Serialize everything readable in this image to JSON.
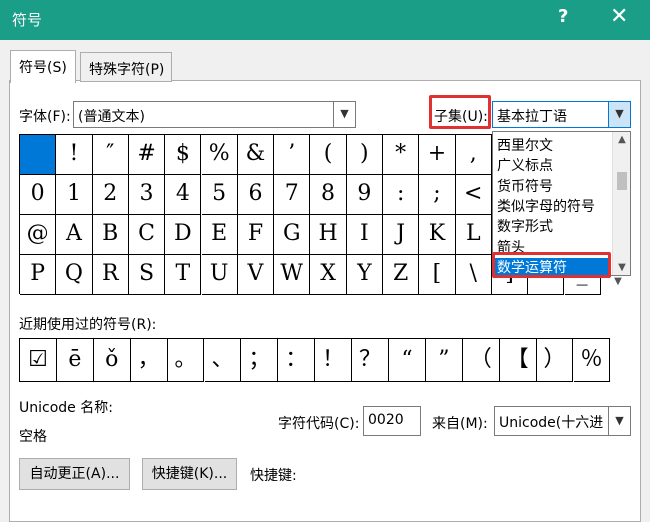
{
  "window": {
    "title": "符号",
    "help": "?",
    "close": "✕"
  },
  "tabs": [
    {
      "label": "符号(S)"
    },
    {
      "label": "特殊字符(P)"
    }
  ],
  "font": {
    "label": "字体(F):",
    "value": "(普通文本)"
  },
  "subset": {
    "label": "子集(U):",
    "value": "基本拉丁语"
  },
  "subset_dropdown": {
    "items": [
      "西里尔文",
      "广义标点",
      "货币符号",
      "类似字母的符号",
      "数字形式",
      "箭头",
      "数学运算符"
    ],
    "highlighted_index": 6
  },
  "symbols": {
    "rows": [
      [
        "",
        "!",
        "″",
        "#",
        "$",
        "%",
        "&",
        "’",
        "(",
        ")",
        "*",
        "+",
        ","
      ],
      [
        "0",
        "1",
        "2",
        "3",
        "4",
        "5",
        "6",
        "7",
        "8",
        "9",
        ":",
        ";",
        "<"
      ],
      [
        "@",
        "A",
        "B",
        "C",
        "D",
        "E",
        "F",
        "G",
        "H",
        "I",
        "J",
        "K",
        "L"
      ],
      [
        "P",
        "Q",
        "R",
        "S",
        "T",
        "U",
        "V",
        "W",
        "X",
        "Y",
        "Z",
        "[",
        "\\"
      ]
    ],
    "selected": [
      0,
      0
    ],
    "overflow": [
      "]",
      "^",
      "_"
    ]
  },
  "recent": {
    "label": "近期使用过的符号(R):",
    "items": [
      "☑",
      "ē",
      "ǒ",
      "，",
      "。",
      "、",
      "；",
      "：",
      "！",
      "？",
      "“",
      "”",
      "（",
      "【",
      "）",
      "％"
    ]
  },
  "unicode_name_label": "Unicode 名称:",
  "unicode_name_value": "空格",
  "char_code": {
    "label": "字符代码(C):",
    "value": "0020"
  },
  "from": {
    "label": "来自(M):",
    "value": "Unicode(十六进"
  },
  "buttons": {
    "autocorrect": "自动更正(A)...",
    "shortcut": "快捷键(K)...",
    "shortcut_label": "快捷键:"
  }
}
